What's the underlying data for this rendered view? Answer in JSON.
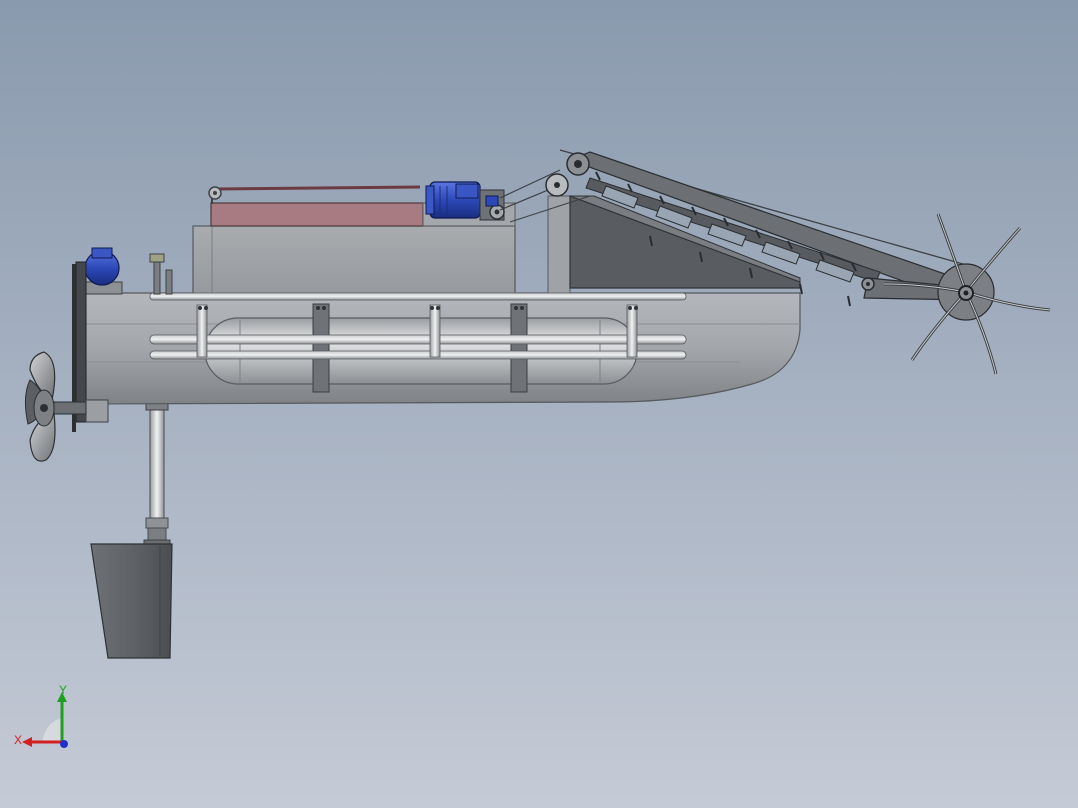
{
  "viewport": {
    "background_top": "#8a9aae",
    "background_bottom": "#c5cbd6"
  },
  "model": {
    "hull_color": "#9b9ea3",
    "deck_box_color": "#a4a7ab",
    "conveyor_box_color": "#a87a82",
    "motor_color": "#2d49b8",
    "frame_color": "#5a5e63",
    "rudder_color": "#63676b"
  },
  "triad": {
    "x_label": "X",
    "y_label": "Y",
    "x_color": "#d22020",
    "y_color": "#20a020",
    "z_color": "#2030c8"
  }
}
